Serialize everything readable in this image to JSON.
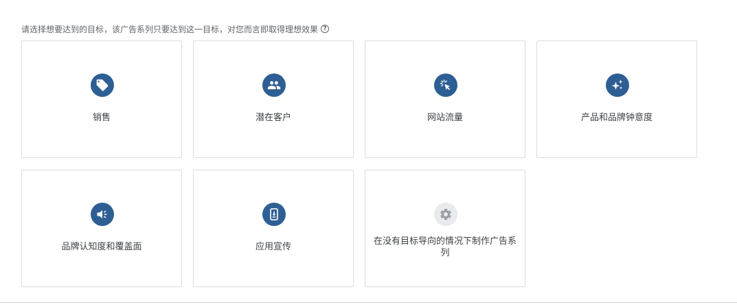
{
  "intro": {
    "text": "请选择想要达到的目标，该广告系列只要达到这一目标，对您而言即取得理想效果",
    "help_icon_glyph": "?"
  },
  "goals": [
    {
      "id": "sales",
      "label": "销售",
      "icon": "tag-icon"
    },
    {
      "id": "leads",
      "label": "潜在客户",
      "icon": "people-icon"
    },
    {
      "id": "website-traffic",
      "label": "网站流量",
      "icon": "cursor-click-icon"
    },
    {
      "id": "consideration",
      "label": "产品和品牌钟意度",
      "icon": "sparkle-icon"
    },
    {
      "id": "awareness",
      "label": "品牌认知度和覆盖面",
      "icon": "megaphone-icon"
    },
    {
      "id": "app-promotion",
      "label": "应用宣传",
      "icon": "phone-download-icon"
    },
    {
      "id": "no-goal",
      "label": "在没有目标导向的情况下制作广告系列",
      "icon": "gear-icon"
    }
  ],
  "colors": {
    "icon_circle": "#2e5f94",
    "icon_circle_disabled": "#e8eaed",
    "icon_glyph_disabled": "#9aa0a6",
    "card_border": "#dadce0"
  }
}
